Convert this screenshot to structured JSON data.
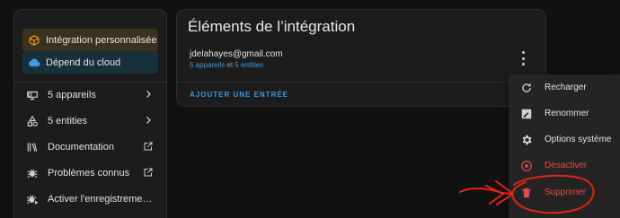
{
  "sidebar": {
    "badges": [
      {
        "label": "Intégration personnalisée",
        "icon": "package-icon",
        "color": "#f0a020"
      },
      {
        "label": "Dépend du cloud",
        "icon": "cloud-icon",
        "color": "#3b9ae0"
      }
    ],
    "items": [
      {
        "label": "5 appareils",
        "icon": "devices-icon",
        "trail": "chevron-right-icon"
      },
      {
        "label": "5 entities",
        "icon": "shapes-icon",
        "trail": "chevron-right-icon"
      },
      {
        "label": "Documentation",
        "icon": "book-icon",
        "trail": "open-in-new-icon"
      },
      {
        "label": "Problèmes connus",
        "icon": "bug-icon",
        "trail": "open-in-new-icon"
      },
      {
        "label": "Activer l'enregistrement des jo...",
        "icon": "bug-play-icon",
        "trail": ""
      }
    ]
  },
  "card": {
    "title": "Éléments de l’intégration",
    "account_email": "jdelahayes@gmail.com",
    "devices_link": "5 appareils",
    "and_text": "et",
    "entities_link": "5 entities",
    "add_entry_label": "AJOUTER UNE ENTRÉE"
  },
  "menu": {
    "items": [
      {
        "label": "Recharger",
        "icon": "reload-icon",
        "danger": false
      },
      {
        "label": "Renommer",
        "icon": "rename-icon",
        "danger": false
      },
      {
        "label": "Options système",
        "icon": "gear-icon",
        "danger": false
      },
      {
        "label": "Désactiver",
        "icon": "stop-circle-icon",
        "danger": true
      },
      {
        "label": "Supprimer",
        "icon": "trash-icon",
        "danger": true
      }
    ]
  },
  "colors": {
    "accent": "#3b9ae0",
    "danger": "#e04b45",
    "annotation": "#e2231a"
  }
}
